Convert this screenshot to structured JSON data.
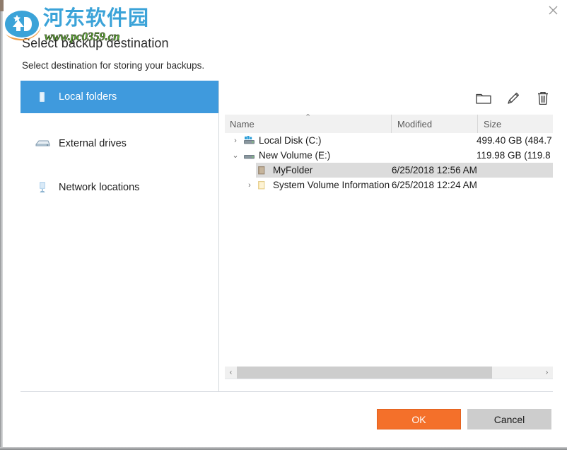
{
  "window": {
    "close_icon": "close-icon"
  },
  "header": {
    "title": "Select backup destination",
    "subtitle": "Select destination for storing your backups."
  },
  "sidebar": {
    "items": [
      {
        "id": "local-folders",
        "label": "Local folders",
        "icon": "folder-drive-icon",
        "selected": true
      },
      {
        "id": "external-drives",
        "label": "External drives",
        "icon": "external-drive-icon",
        "selected": false
      },
      {
        "id": "network-locations",
        "label": "Network locations",
        "icon": "network-drive-icon",
        "selected": false
      }
    ]
  },
  "browser": {
    "toolbar": [
      {
        "id": "new-folder",
        "icon": "new-folder-icon",
        "tooltip": "New folder"
      },
      {
        "id": "rename",
        "icon": "pencil-icon",
        "tooltip": "Rename"
      },
      {
        "id": "delete",
        "icon": "trash-icon",
        "tooltip": "Delete"
      }
    ],
    "columns": [
      {
        "id": "name",
        "label": "Name",
        "sort": "asc",
        "sort_caret": "⌃"
      },
      {
        "id": "modified",
        "label": "Modified",
        "sort": ""
      },
      {
        "id": "size",
        "label": "Size",
        "sort": ""
      }
    ],
    "rows": [
      {
        "name": "Local Disk (C:)",
        "modified": "",
        "size": "499.40 GB (484.7",
        "level": 0,
        "expander": "›",
        "expanded": false,
        "icon": "hard-drive-icon",
        "selected": false
      },
      {
        "name": "New Volume (E:)",
        "modified": "",
        "size": "119.98 GB (119.8",
        "level": 0,
        "expander": "⌄",
        "expanded": true,
        "icon": "hard-drive-icon",
        "selected": false
      },
      {
        "name": "MyFolder",
        "modified": "6/25/2018 12:56 AM",
        "size": "",
        "level": 1,
        "expander": "",
        "expanded": false,
        "icon": "folder-icon-brown",
        "selected": true
      },
      {
        "name": "System Volume Information",
        "modified": "6/25/2018 12:24 AM",
        "size": "",
        "level": 1,
        "expander": "›",
        "expanded": false,
        "icon": "folder-icon-yellow",
        "selected": false
      }
    ],
    "scrollbar": {
      "left_arrow": "‹",
      "right_arrow": "›",
      "thumb_fraction": 0.84
    }
  },
  "footer": {
    "ok_label": "OK",
    "cancel_label": "Cancel"
  },
  "watermark": {
    "site_name": "河东软件园",
    "url": "www.pc0359.cn",
    "logo_icon": "pc0359-logo-icon"
  },
  "colors": {
    "accent_blue": "#3f9add",
    "ok_orange": "#f4702a",
    "cancel_grey": "#cdcdcd",
    "selection_grey": "#dcdcdc",
    "header_grey": "#f1f1f1",
    "watermark_blue": "#3ba3d8",
    "watermark_green": "#5bb033"
  }
}
